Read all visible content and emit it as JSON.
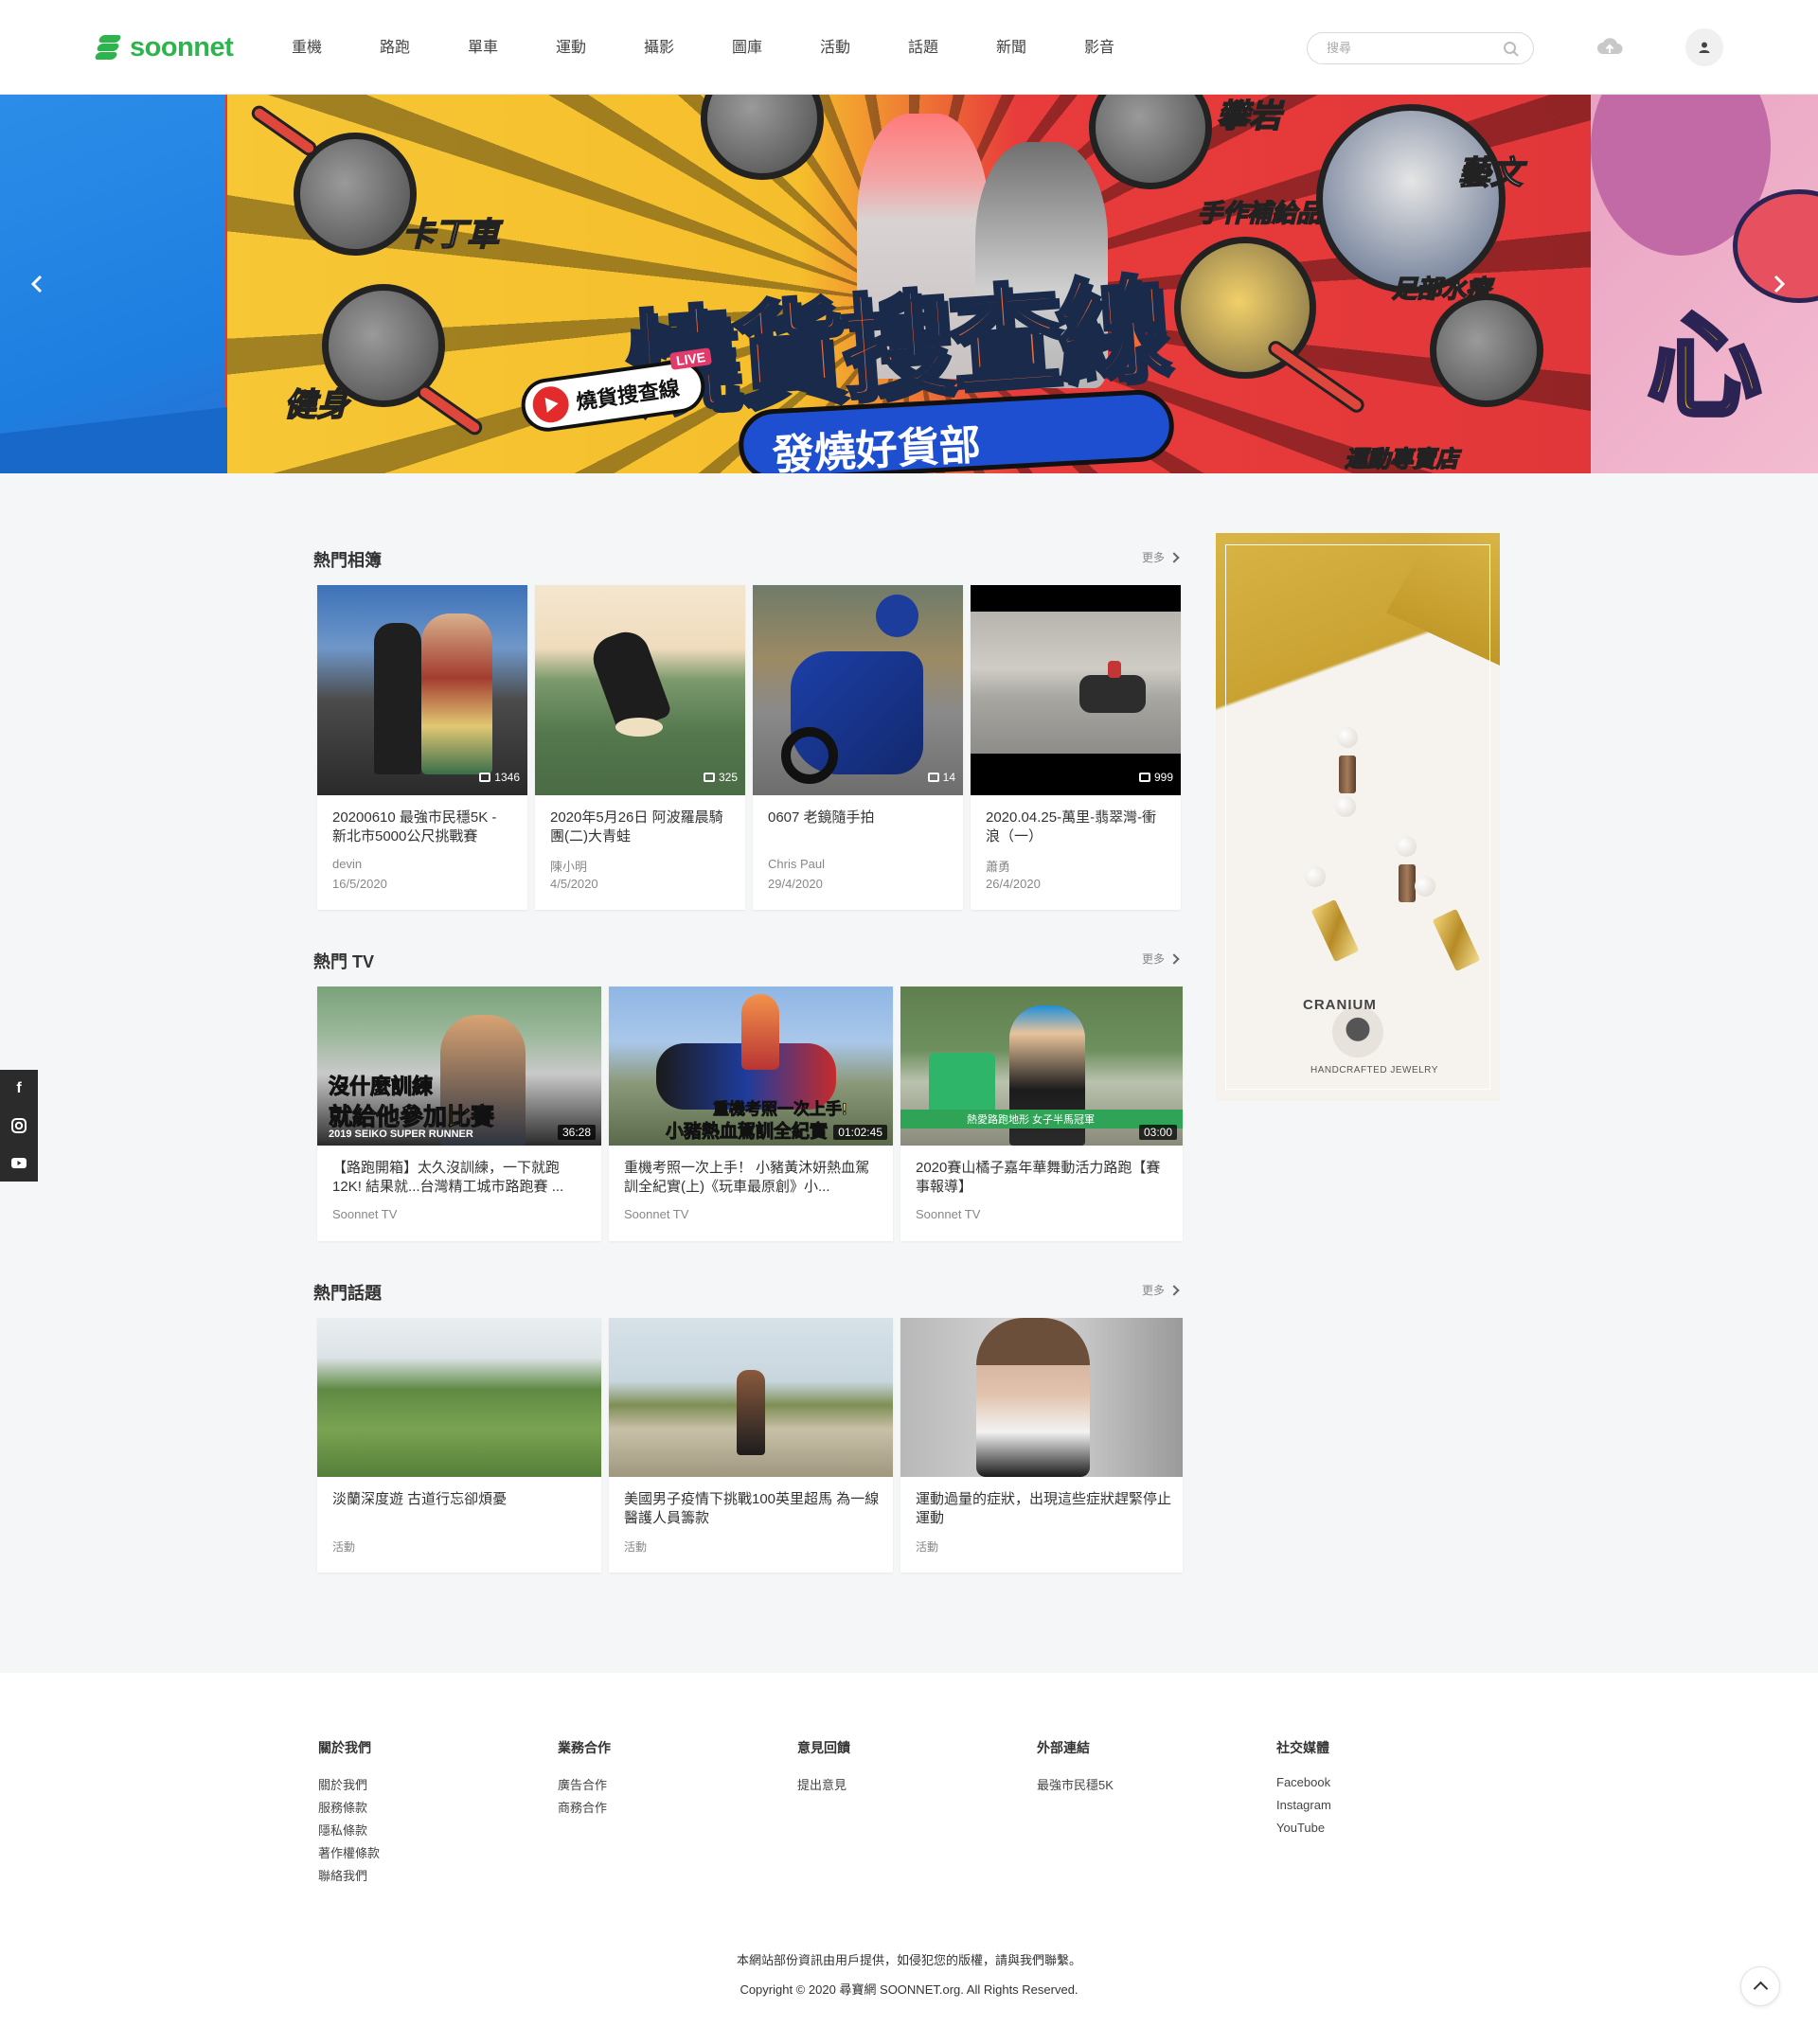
{
  "brand": {
    "name": "soonnet",
    "color": "#2db44d"
  },
  "nav": [
    "重機",
    "路跑",
    "單車",
    "運動",
    "攝影",
    "圖庫",
    "活動",
    "話題",
    "新聞",
    "影音"
  ],
  "search": {
    "placeholder": "搜尋"
  },
  "icons": {
    "search": "search-icon",
    "upload": "cloud-upload-icon",
    "user": "user-icon",
    "prev": "chevron-left-icon",
    "next": "chevron-right-icon"
  },
  "banner": {
    "headline": "燒貨搜查線",
    "subline": "發燒好貨部",
    "live_pill": "燒貨搜查線",
    "live_tag": "LIVE",
    "labels": [
      "卡丁車",
      "健身",
      "攀岩",
      "藝文",
      "手作補給品",
      "足部水療",
      "運動專賣店"
    ],
    "right_word": "心"
  },
  "albums": {
    "title": "熱門相簿",
    "more": "更多",
    "items": [
      {
        "title": "20200610 最強市民穩5K - 新北市5000公尺挑戰賽",
        "author": "devin",
        "date": "16/5/2020",
        "count": "1346"
      },
      {
        "title": "2020年5月26日 阿波羅晨騎團(二)大青蛙",
        "author": "陳小明",
        "date": "4/5/2020",
        "count": "325"
      },
      {
        "title": "0607 老鏡隨手拍",
        "author": "Chris Paul",
        "date": "29/4/2020",
        "count": "14"
      },
      {
        "title": "2020.04.25-萬里-翡翠灣-衝浪（一）",
        "author": "蕭勇",
        "date": "26/4/2020",
        "count": "999"
      }
    ]
  },
  "tv": {
    "title": "熱門 TV",
    "more": "更多",
    "items": [
      {
        "title": "【路跑開箱】太久沒訓練，一下就跑12K! 結果就...台灣精工城市路跑賽 ...",
        "channel": "Soonnet TV",
        "duration": "36:28",
        "overlay1": "沒什麼訓練",
        "overlay2": "就給他參加比賽",
        "overlay3": "2019 SEIKO SUPER RUNNER"
      },
      {
        "title": "重機考照一次上手！ 小豬黃沐妍熱血駕訓全紀實(上)《玩車最原創》小...",
        "channel": "Soonnet TV",
        "duration": "01:02:45",
        "overlay1": "重機考照一次上手!",
        "overlay2": "小豬熱血駕訓全紀實"
      },
      {
        "title": "2020賽山橘子嘉年華舞動活力路跑【賽事報導】",
        "channel": "Soonnet TV",
        "duration": "03:00",
        "overlay1": "熱愛路跑地形 女子半馬冠軍"
      }
    ]
  },
  "topics": {
    "title": "熱門話題",
    "more": "更多",
    "items": [
      {
        "title": "淡蘭深度遊 古道行忘卻煩憂",
        "category": "活動"
      },
      {
        "title": "美國男子疫情下挑戰100英里超馬 為一線醫護人員籌款",
        "category": "活動"
      },
      {
        "title": "運動過量的症狀，出現這些症狀趕緊停止運動",
        "category": "活動"
      }
    ]
  },
  "ad": {
    "brand": "CRANIUM",
    "tagline": "HANDCRAFTED JEWELRY"
  },
  "social_side": [
    "facebook-icon",
    "instagram-icon",
    "youtube-icon"
  ],
  "footer": {
    "columns": [
      {
        "title": "關於我們",
        "links": [
          "關於我們",
          "服務條款",
          "隱私條款",
          "著作權條款",
          "聯絡我們"
        ]
      },
      {
        "title": "業務合作",
        "links": [
          "廣告合作",
          "商務合作"
        ]
      },
      {
        "title": "意見回饋",
        "links": [
          "提出意見"
        ]
      },
      {
        "title": "外部連結",
        "links": [
          "最強市民穩5K"
        ]
      },
      {
        "title": "社交媒體",
        "links": [
          "Facebook",
          "Instagram",
          "YouTube"
        ]
      }
    ],
    "note": "本網站部份資訊由用戶提供，如侵犯您的版權，請與我們聯繫。",
    "copyright": "Copyright © 2020 尋寶網 SOONNET.org. All Rights Reserved."
  }
}
